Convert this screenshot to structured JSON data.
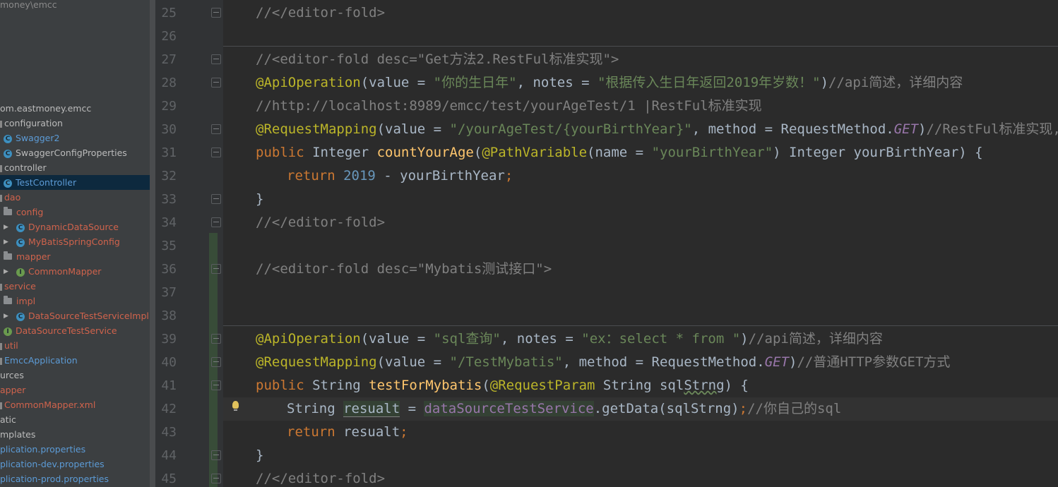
{
  "project_tree": {
    "items": [
      {
        "label": "money\\emcc",
        "indent": 0,
        "icon": "none",
        "style": "gray"
      },
      {
        "label": "om.eastmoney.emcc",
        "indent": 0,
        "icon": "none",
        "style": "normal"
      },
      {
        "label": "configuration",
        "indent": 0,
        "icon": "square",
        "style": "normal"
      },
      {
        "label": "Swagger2",
        "indent": 4,
        "icon": "class",
        "style": "blue"
      },
      {
        "label": "SwaggerConfigProperties",
        "indent": 4,
        "icon": "class",
        "style": "normal"
      },
      {
        "label": "controller",
        "indent": 0,
        "icon": "square",
        "style": "normal"
      },
      {
        "label": "TestController",
        "indent": 4,
        "icon": "class",
        "style": "blue",
        "selected": true
      },
      {
        "label": "dao",
        "indent": 0,
        "icon": "square",
        "style": "red"
      },
      {
        "label": "config",
        "indent": 4,
        "icon": "folder",
        "style": "red"
      },
      {
        "label": "DynamicDataSource",
        "indent": 4,
        "icon": "class",
        "style": "red",
        "arrow": true
      },
      {
        "label": "MyBatisSpringConfig",
        "indent": 4,
        "icon": "class",
        "style": "red",
        "arrow": true
      },
      {
        "label": "mapper",
        "indent": 4,
        "icon": "folder",
        "style": "red"
      },
      {
        "label": "CommonMapper",
        "indent": 4,
        "icon": "interface",
        "style": "red",
        "arrow": true
      },
      {
        "label": "service",
        "indent": 0,
        "icon": "square",
        "style": "red"
      },
      {
        "label": "impl",
        "indent": 4,
        "icon": "folder",
        "style": "red"
      },
      {
        "label": "DataSourceTestServiceImpl",
        "indent": 4,
        "icon": "class",
        "style": "red",
        "arrow": true
      },
      {
        "label": "DataSourceTestService",
        "indent": 4,
        "icon": "interface",
        "style": "red"
      },
      {
        "label": "util",
        "indent": 0,
        "icon": "square",
        "style": "red"
      },
      {
        "label": "EmccApplication",
        "indent": 0,
        "icon": "square",
        "style": "blue"
      },
      {
        "label": "urces",
        "indent": 0,
        "icon": "none",
        "style": "normal"
      },
      {
        "label": "apper",
        "indent": 0,
        "icon": "none",
        "style": "red"
      },
      {
        "label": "CommonMapper.xml",
        "indent": 0,
        "icon": "square",
        "style": "red"
      },
      {
        "label": "mplates",
        "indent": 0,
        "icon": "none",
        "style": "normal"
      },
      {
        "label": "atic",
        "indent": 0,
        "icon": "none",
        "style": "normal"
      },
      {
        "label": "plication.properties",
        "indent": 0,
        "icon": "none",
        "style": "blue"
      },
      {
        "label": "plication-dev.properties",
        "indent": 0,
        "icon": "none",
        "style": "blue"
      },
      {
        "label": "plication-prod.properties",
        "indent": 0,
        "icon": "none",
        "style": "blue"
      }
    ]
  },
  "editor": {
    "line_numbers": [
      "25",
      "26",
      "27",
      "28",
      "29",
      "30",
      "31",
      "32",
      "33",
      "34",
      "35",
      "36",
      "37",
      "38",
      "39",
      "40",
      "41",
      "42",
      "43",
      "44",
      "45"
    ],
    "lines": {
      "l25": {
        "c1": "//</editor-fold>"
      },
      "l27": {
        "c1": "//<editor-fold desc=\"Get方法2.RestFul标准实现\">"
      },
      "l28": {
        "a": "@ApiOperation",
        "b": "(value = ",
        "c": "\"你的生日年\"",
        "d": ", notes = ",
        "e": "\"根据传入生日年返回2019年岁数！\"",
        "f": ")",
        "g": "//api简述，详细内容"
      },
      "l29": {
        "c1": "//http://localhost:8989/emcc/test/yourAgeTest/1 |RestFul标准实现"
      },
      "l30": {
        "a": "@RequestMapping",
        "b": "(value = ",
        "c": "\"/yourAgeTest/{yourBirthYear}\"",
        "d": ", method = RequestMethod.",
        "e": "GET",
        "f": ")",
        "g": "//RestFul标准实现,必须"
      },
      "l31": {
        "a": "public ",
        "b": "Integer ",
        "c": "countYourAge",
        "d": "(",
        "e": "@PathVariable",
        "f": "(name = ",
        "g": "\"yourBirthYear\"",
        "h": ") Integer yourBirthYear) {"
      },
      "l32": {
        "a": "return ",
        "b": "2019",
        "c": " - yourBirthYear",
        "d": ";"
      },
      "l33": {
        "c1": "}"
      },
      "l34": {
        "c1": "//</editor-fold>"
      },
      "l36": {
        "c1": "//<editor-fold desc=\"Mybatis测试接口\">"
      },
      "l39": {
        "a": "@ApiOperation",
        "b": "(value = ",
        "c": "\"sql查询\"",
        "d": ", notes = ",
        "e": "\"ex：select * from \"",
        "f": ")",
        "g": "//api简述，详细内容"
      },
      "l40": {
        "a": "@RequestMapping",
        "b": "(value = ",
        "c": "\"/TestMybatis\"",
        "d": ", method = RequestMethod.",
        "e": "GET",
        "f": ")",
        "g": "//普通HTTP参数GET方式"
      },
      "l41": {
        "a": "public ",
        "b": "String ",
        "c": "testForMybatis",
        "d": "(",
        "e": "@RequestParam",
        "f": " String sql",
        "g": "Strng",
        "h": ") {"
      },
      "l42": {
        "a": "String ",
        "b": "resualt",
        "c": " = ",
        "d": "dataSourceTestService",
        "e": ".getData(sqlStrng)",
        "f": ";",
        "g": "//你自己的sql"
      },
      "l43": {
        "a": "return ",
        "b": "resualt",
        "c": ";"
      },
      "l44": {
        "c1": "}"
      },
      "l45": {
        "c1": "//</editor-fold>"
      }
    }
  },
  "colors": {
    "comment": "#808080",
    "annotation": "#bbb529",
    "string": "#6a8759",
    "keyword": "#cc7832",
    "number": "#6897bb",
    "method": "#ffc66d",
    "field": "#9876aa"
  }
}
